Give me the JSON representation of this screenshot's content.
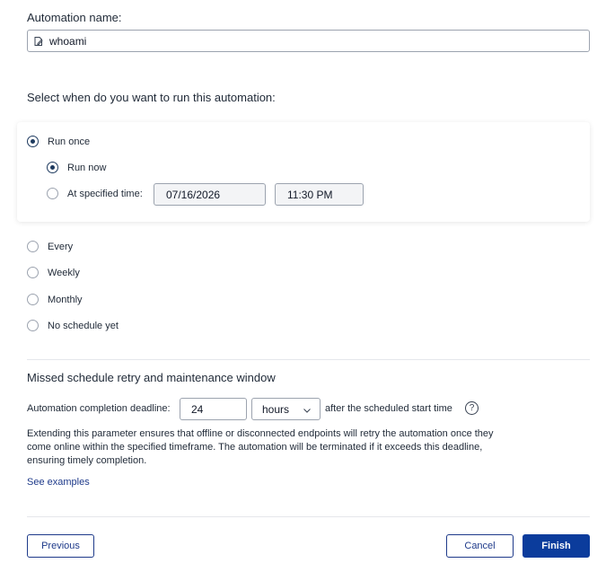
{
  "automation_name": {
    "label": "Automation name:",
    "value": "whoami",
    "icon": "edit-icon"
  },
  "schedule": {
    "question": "Select when do you want to run this automation:",
    "run_once": {
      "label": "Run once",
      "selected": true
    },
    "run_now": {
      "label": "Run now",
      "selected": true
    },
    "at_specified": {
      "label": "At specified time:",
      "selected": false,
      "date": "07/16/2026",
      "time": "11:30 PM"
    },
    "options": [
      {
        "label": "Every"
      },
      {
        "label": "Weekly"
      },
      {
        "label": "Monthly"
      },
      {
        "label": "No schedule yet"
      }
    ]
  },
  "missed": {
    "title": "Missed schedule retry and maintenance window",
    "deadline_label": "Automation completion deadline:",
    "deadline_value": "24",
    "unit": "hours",
    "after_label": "after the scheduled start time",
    "help": "?",
    "description": "Extending this parameter ensures that offline or disconnected endpoints will retry the automation once they come online within the specified timeframe. The automation will be terminated if it exceeds this deadline, ensuring timely completion.",
    "see_examples": "See examples"
  },
  "footer": {
    "previous": "Previous",
    "cancel": "Cancel",
    "finish": "Finish"
  },
  "colors": {
    "primary": "#0b3c9c",
    "radio_checked": "#1e3a5f"
  }
}
